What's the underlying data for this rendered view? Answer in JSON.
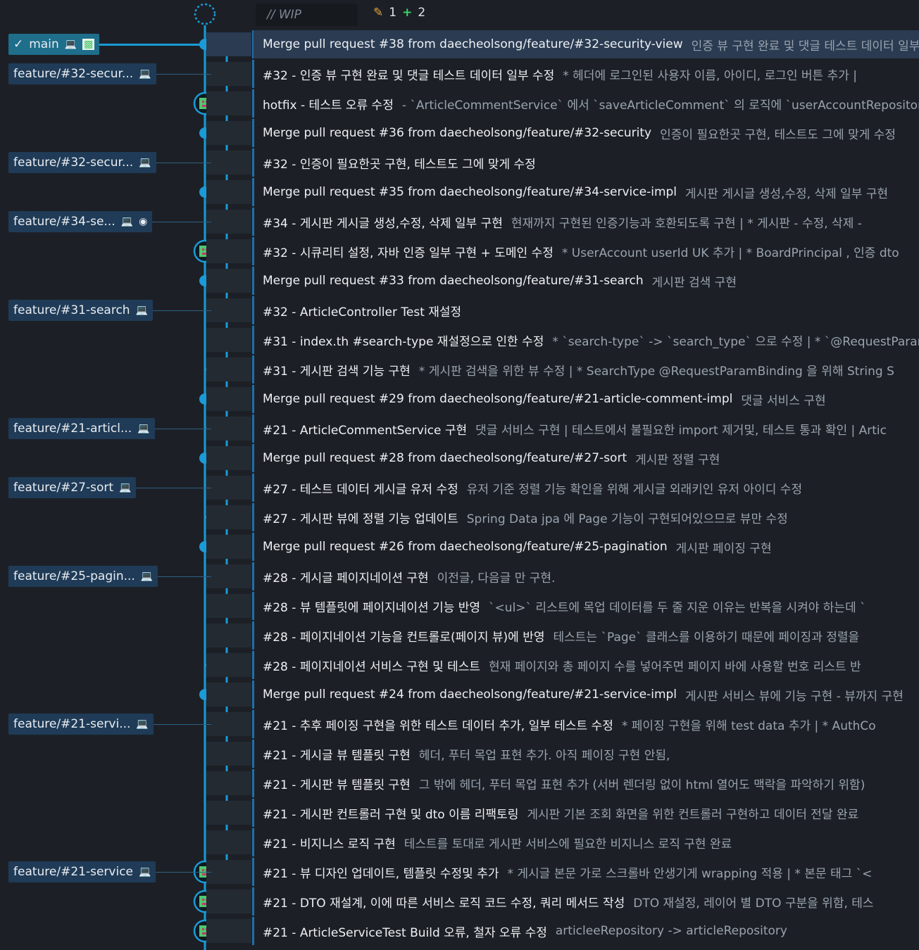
{
  "wip": {
    "placeholder": "// WIP",
    "modified_count": "1",
    "added_count": "2"
  },
  "colors": {
    "background": "#1c2026",
    "graph_line": "#1a9bd7",
    "selected_row": "#2a3b52",
    "main_tag": "#1e6e8c",
    "branch_tag": "#1f3b57",
    "added_green": "#3cd16a"
  },
  "refs": [
    {
      "label": "main",
      "kind": "main",
      "row": 1,
      "icons": [
        "check-icon",
        "laptop-icon",
        "avatar-icon"
      ]
    },
    {
      "label": "feature/#32-secur...",
      "kind": "branch",
      "row": 2,
      "icons": [
        "laptop-icon"
      ]
    },
    {
      "label": "feature/#32-secur...",
      "kind": "branch",
      "row": 5,
      "icons": [
        "laptop-icon"
      ]
    },
    {
      "label": "feature/#34-se...",
      "kind": "branch",
      "row": 7,
      "icons": [
        "laptop-icon",
        "github-icon"
      ]
    },
    {
      "label": "feature/#31-search",
      "kind": "branch",
      "row": 10,
      "icons": [
        "laptop-icon"
      ]
    },
    {
      "label": "feature/#21-articl...",
      "kind": "branch",
      "row": 14,
      "icons": [
        "laptop-icon"
      ]
    },
    {
      "label": "feature/#27-sort",
      "kind": "branch",
      "row": 16,
      "icons": [
        "laptop-icon"
      ]
    },
    {
      "label": "feature/#25-pagin...",
      "kind": "branch",
      "row": 19,
      "icons": [
        "laptop-icon"
      ]
    },
    {
      "label": "feature/#21-servi...",
      "kind": "branch",
      "row": 24,
      "icons": [
        "laptop-icon"
      ]
    },
    {
      "label": "feature/#21-service",
      "kind": "branch",
      "row": 29,
      "icons": [
        "laptop-icon"
      ]
    }
  ],
  "commits": [
    {
      "msg": "Merge pull request #38 from daecheolsong/feature/#32-security-view",
      "desc": "인증 뷰 구현 완료 및 댓글 테스트 데이터 일부 수정",
      "node": "merge",
      "lane": 0,
      "selected": true
    },
    {
      "msg": "#32 - 인증 뷰 구현 완료 및 댓글 테스트 데이터 일부 수정",
      "desc": "* 헤더에 로그인된 사용자 이름, 아이디, 로그인 버튼 추가 |",
      "node": "avatar",
      "lane": 1
    },
    {
      "msg": "hotfix - 테스트 오류 수정",
      "desc": "- `ArticleCommentService` 에서 `saveArticleComment` 의 로직에 `userAccountRepository",
      "node": "avatar",
      "lane": 0
    },
    {
      "msg": "Merge pull request #36 from daecheolsong/feature/#32-security",
      "desc": "인증이 필요한곳 구현, 테스트도 그에 맞게 수정",
      "node": "merge",
      "lane": 0
    },
    {
      "msg": "#32 - 인증이 필요한곳 구현, 테스트도 그에 맞게 수정",
      "desc": "",
      "node": "avatar",
      "lane": 1
    },
    {
      "msg": "Merge pull request #35 from daecheolsong/feature/#34-service-impl",
      "desc": "게시판 게시글 생성,수정, 삭제 일부 구현",
      "node": "merge",
      "lane": 0
    },
    {
      "msg": "#34 - 게시판 게시글 생성,수정, 삭제 일부 구현",
      "desc": "현재까지 구현된 인증기능과 호환되도록 구현 | * 게시판 - 수정, 삭제 -",
      "node": "avatar",
      "lane": 1
    },
    {
      "msg": "#32 - 시큐리티 설정, 자바 인증 일부 구현 + 도메인 수정",
      "desc": "* UserAccount userId UK 추가 | * BoardPrincipal , 인증 dto",
      "node": "avatar",
      "lane": 0
    },
    {
      "msg": "Merge pull request #33 from daecheolsong/feature/#31-search",
      "desc": "게시판 검색 구현",
      "node": "merge",
      "lane": 0
    },
    {
      "msg": "#32 - ArticleController Test 재설정",
      "desc": "",
      "node": "avatar",
      "lane": 1
    },
    {
      "msg": "#31 - index.th #search-type 재설정으로 인한 수정",
      "desc": "* `search-type` -> `search_type` 으로 수정 | * `@RequestParam",
      "node": "avatar",
      "lane": 1
    },
    {
      "msg": "#31 - 게시판 검색 기능 구현",
      "desc": "* 게시판 검색을 위한 뷰 수정 | * SearchType @RequestParamBinding 을 위해 String S",
      "node": "avatar",
      "lane": 1
    },
    {
      "msg": "Merge pull request #29 from daecheolsong/feature/#21-article-comment-impl",
      "desc": "댓글 서비스 구현",
      "node": "merge",
      "lane": 0
    },
    {
      "msg": "#21 - ArticleCommentService 구현",
      "desc": "댓글 서비스 구현 | 테스트에서 불필요한 import 제거및, 테스트 통과 확인 | Artic",
      "node": "avatar",
      "lane": 1
    },
    {
      "msg": "Merge pull request #28 from daecheolsong/feature/#27-sort",
      "desc": "게시판 정렬 구현",
      "node": "merge",
      "lane": 0
    },
    {
      "msg": "#27 - 테스트 데이터 게시글 유저 수정",
      "desc": "유저 기준 정렬 기능 확인을 위해 게시글 외래키인 유저 아이디 수정",
      "node": "avatar",
      "lane": 1
    },
    {
      "msg": "#27 - 게시판 뷰에 정렬 기능 업데이트",
      "desc": "Spring Data jpa 에 Page 기능이 구현되어있으므로 뷰만 수정",
      "node": "avatar",
      "lane": 1
    },
    {
      "msg": "Merge pull request #26 from daecheolsong/feature/#25-pagination",
      "desc": "게시판 페이징 구현",
      "node": "merge",
      "lane": 0
    },
    {
      "msg": "#28 - 게시글 페이지네이션 구현",
      "desc": "이전글, 다음글 만 구현.",
      "node": "avatar",
      "lane": 1
    },
    {
      "msg": "#28 - 뷰 템플릿에 페이지네이션 기능 반영",
      "desc": "`<ul>` 리스트에 목업 데이터를 두 줄 지운 이유는 반복을 시켜야 하는데 `",
      "node": "avatar",
      "lane": 1
    },
    {
      "msg": "#28 - 페이지네이션 기능을 컨트롤로(페이지 뷰)에 반영",
      "desc": "테스트는 `Page` 클래스를 이용하기 때문에 페이징과 정렬을",
      "node": "avatar",
      "lane": 1
    },
    {
      "msg": "#28 - 페이지네이션 서비스 구현 및 테스트",
      "desc": "현재 페이지와 총 페이지 수를 넣어주면 페이지 바에 사용할 번호 리스트 반",
      "node": "avatar",
      "lane": 1
    },
    {
      "msg": "Merge pull request #24 from daecheolsong/feature/#21-service-impl",
      "desc": "게시판 서비스 뷰에 기능 구현 - 뷰까지 구현",
      "node": "merge",
      "lane": 0
    },
    {
      "msg": "#21 - 추후 페이징 구현을 위한 테스트 데이터 추가, 일부 테스트 수정",
      "desc": "* 페이징 구현을 위해 test data 추가 | * AuthCo",
      "node": "avatar",
      "lane": 1
    },
    {
      "msg": "#21 - 게시글 뷰 템플릿 구현",
      "desc": "헤더, 푸터 목업 표현 추가. 아직 페이징 구현 안됨,",
      "node": "avatar",
      "lane": 1
    },
    {
      "msg": "#21 - 게시판 뷰 템플릿 구현",
      "desc": "그 밖에 헤더, 푸터 목업 표현 추가 (서버 렌더링 없이 html 열어도 맥락을 파악하기 위함)",
      "node": "avatar",
      "lane": 1
    },
    {
      "msg": "#21 - 게시판 컨트롤러 구현 및 dto 이름 리팩토링",
      "desc": "게시판 기본 조회 화면을 위한 컨트롤러 구현하고 데이터 전달 완료",
      "node": "avatar",
      "lane": 1
    },
    {
      "msg": "#21 - 비지니스 로직 구현",
      "desc": "테스트를 토대로 게시판 서비스에 필요한 비지니스 로직 구현 완료",
      "node": "avatar",
      "lane": 1
    },
    {
      "msg": "#21 - 뷰 디자인 업데이트, 템플릿 수정및 추가",
      "desc": "* 게시글 본문 가로 스크롤바 안생기게 wrapping 적용 | * 본문 태그 `<",
      "node": "avatar",
      "lane": 0
    },
    {
      "msg": "#21 - DTO 재설계, 이에 따른 서비스 로직 코드 수정, 쿼리 메서드 작성",
      "desc": "DTO 재설정, 레이어 별 DTO 구분을 위함, 테스",
      "node": "avatar",
      "lane": 0
    },
    {
      "msg": "#21 - ArticleServiceTest Build 오류, 철자 오류 수정",
      "desc": "articleeRepository -> articleRepository",
      "node": "avatar",
      "lane": 0
    }
  ],
  "merge_spans": [
    [
      1,
      7
    ],
    [
      8,
      11
    ],
    [
      12,
      13
    ],
    [
      14,
      16
    ],
    [
      17,
      21
    ],
    [
      22,
      28
    ]
  ]
}
